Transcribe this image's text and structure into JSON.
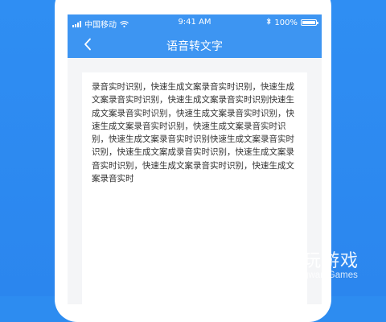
{
  "status_bar": {
    "carrier": "中国移动",
    "time": "9:41 AM",
    "battery_percent": "100%",
    "signal_icon": "cellular-signal-icon",
    "wifi_icon": "wifi-icon",
    "bluetooth_icon": "bluetooth-icon",
    "battery_icon": "battery-icon",
    "battery_level": 1.0
  },
  "nav": {
    "back_icon": "chevron-left-icon",
    "title": "语音转文字"
  },
  "content": {
    "text": "录音实时识别，快速生成文案录音实时识别，快速生成文案录音实时识别，快速生成文案录音实时识别快速生成文案录音实时识别，快速生成文案录音实时识别，快速生成文案录音实时识别，快速生成文案录音实时识别，快速生成文案录音实时识别快速生成文案录音实时识别，快速生成文案成录音实时识别，快速生成文案录音实时识别，快速生成文案录音实时识别，快速生成文案录音实时"
  },
  "watermark": {
    "logo_icon": "rengwan-logo-icon",
    "brand_cn": "仍玩游戏",
    "brand_en": "Rengwan Games"
  },
  "colors": {
    "background": "#2d8cf0",
    "nav_bar": "#3d95f2",
    "text": "#333333",
    "card": "#ffffff"
  }
}
